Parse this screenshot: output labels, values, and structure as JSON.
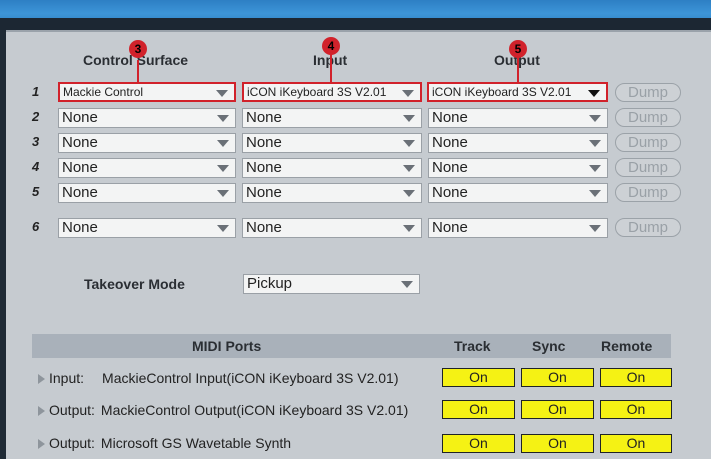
{
  "columns": {
    "control_surface": "Control Surface",
    "input": "Input",
    "output": "Output"
  },
  "rows": [
    {
      "num": "1",
      "surface": "Mackie Control",
      "input": "iCON iKeyboard 3S V2.01",
      "output": "iCON iKeyboard 3S V2.01",
      "dump": "Dump"
    },
    {
      "num": "2",
      "surface": "None",
      "input": "None",
      "output": "None",
      "dump": "Dump"
    },
    {
      "num": "3",
      "surface": "None",
      "input": "None",
      "output": "None",
      "dump": "Dump"
    },
    {
      "num": "4",
      "surface": "None",
      "input": "None",
      "output": "None",
      "dump": "Dump"
    },
    {
      "num": "5",
      "surface": "None",
      "input": "None",
      "output": "None",
      "dump": "Dump"
    },
    {
      "num": "6",
      "surface": "None",
      "input": "None",
      "output": "None",
      "dump": "Dump"
    }
  ],
  "badges": [
    "3",
    "4",
    "5"
  ],
  "takeover": {
    "label": "Takeover Mode",
    "value": "Pickup"
  },
  "midi": {
    "header": "MIDI Ports",
    "track": "Track",
    "sync": "Sync",
    "remote": "Remote",
    "ports": [
      {
        "dir": "Input:",
        "name": "MackieControl Input(iCON iKeyboard 3S V2.01)",
        "track": "On",
        "sync": "On",
        "remote": "On"
      },
      {
        "dir": "Output:",
        "name": "MackieControl Output(iCON iKeyboard 3S V2.01)",
        "track": "On",
        "sync": "On",
        "remote": "On"
      },
      {
        "dir": "Output:",
        "name": "Microsoft GS Wavetable Synth",
        "track": "On",
        "sync": "On",
        "remote": "On"
      }
    ]
  },
  "colors": {
    "highlight": "#d1222b",
    "on_button": "#f5f214",
    "panel": "#c6cbd0",
    "title_bar": "#3d95d8"
  }
}
